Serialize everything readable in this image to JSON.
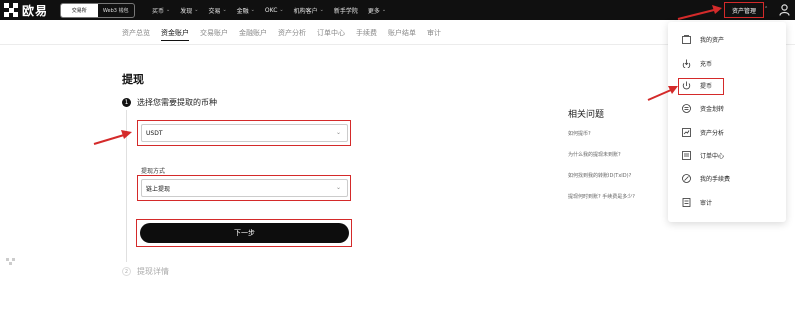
{
  "topbar": {
    "logo_text": "欧易",
    "mode_toggle": {
      "exchange": "交易所",
      "web3": "Web3 钱包"
    },
    "nav": [
      "买币",
      "发现",
      "交易",
      "金融",
      "OKC",
      "机构客户",
      "新手学院",
      "更多"
    ],
    "asset_menu": "资产管理"
  },
  "subnav": [
    "资产总览",
    "资金账户",
    "交易账户",
    "金融账户",
    "资产分析",
    "订单中心",
    "手续费",
    "账户结单",
    "审计"
  ],
  "page": {
    "title": "提现",
    "step1": {
      "num": "1",
      "label": "选择您需要提取的币种"
    },
    "coin_select": {
      "value": "USDT"
    },
    "method_label": "提现方式",
    "method_select": {
      "value": "链上提现"
    },
    "next_button": "下一步",
    "step2": {
      "num": "2",
      "label": "提现详情"
    }
  },
  "faq": {
    "title": "相关问题",
    "items": [
      "如何提币?",
      "为什么我的提现未到账?",
      "如何找到我的转账ID(TxID)?",
      "提现何时到账? 手续费是多少?"
    ]
  },
  "dropdown": {
    "items": [
      {
        "label": "我的资产",
        "icon": "wallet-icon"
      },
      {
        "label": "充币",
        "icon": "deposit-icon"
      },
      {
        "label": "提币",
        "icon": "withdraw-icon"
      },
      {
        "label": "资金划转",
        "icon": "transfer-icon"
      },
      {
        "label": "资产分析",
        "icon": "analysis-icon"
      },
      {
        "label": "订单中心",
        "icon": "orders-icon"
      },
      {
        "label": "我的手续费",
        "icon": "fee-icon"
      },
      {
        "label": "审计",
        "icon": "audit-icon"
      }
    ]
  },
  "colors": {
    "highlight": "#d42a2a",
    "topbar": "#101010",
    "button": "#0d0d0d"
  }
}
